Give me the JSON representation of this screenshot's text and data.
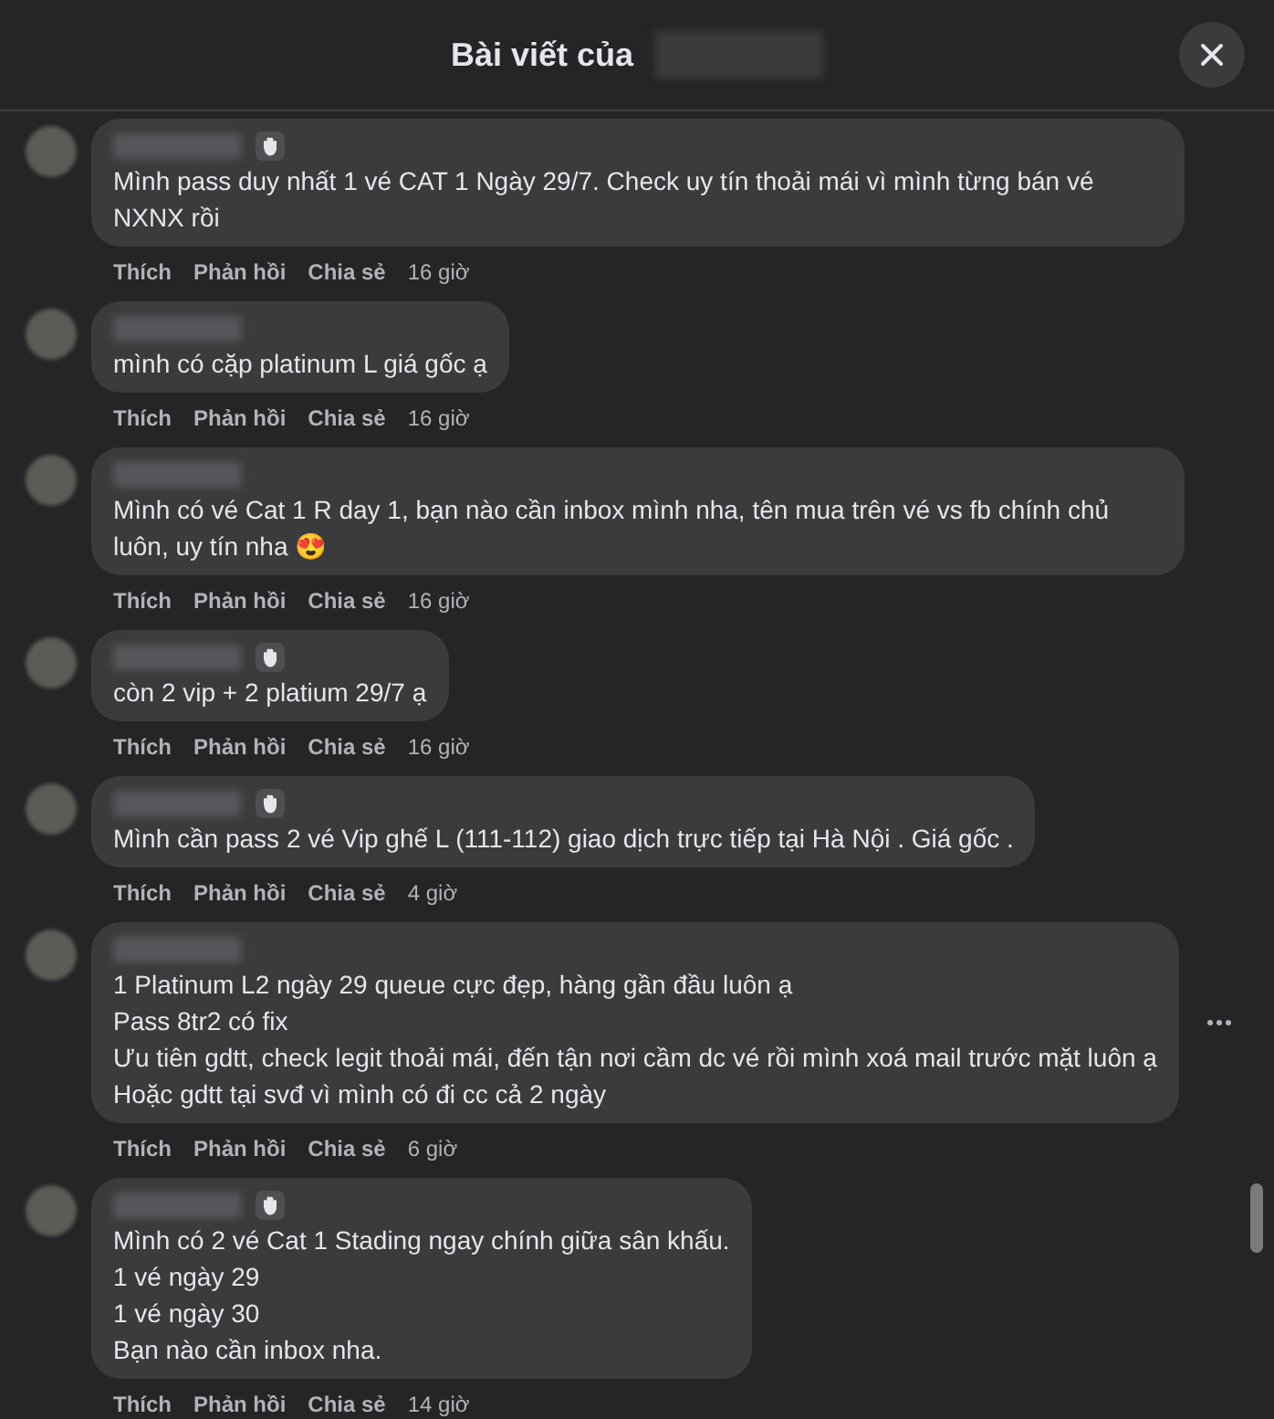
{
  "header": {
    "title": "Bài viết của"
  },
  "comments": [
    {
      "badge": true,
      "lines": [
        "Mình pass duy nhất 1 vé CAT 1 Ngày 29/7. Check uy tín thoải mái vì mình từng bán vé NXNX rồi"
      ],
      "actions": [
        "Thích",
        "Phản hồi",
        "Chia sẻ"
      ],
      "time": "16 giờ",
      "menu": false
    },
    {
      "badge": false,
      "lines": [
        "mình có cặp platinum L giá gốc ạ"
      ],
      "actions": [
        "Thích",
        "Phản hồi",
        "Chia sẻ"
      ],
      "time": "16 giờ",
      "menu": false
    },
    {
      "badge": false,
      "lines": [
        "Mình có vé Cat 1 R day 1, bạn nào cần inbox mình nha, tên mua trên vé vs fb chính chủ luôn, uy tín nha 😍"
      ],
      "actions": [
        "Thích",
        "Phản hồi",
        "Chia sẻ"
      ],
      "time": "16 giờ",
      "menu": false
    },
    {
      "badge": true,
      "lines": [
        "còn 2 vip + 2 platium 29/7 ạ"
      ],
      "actions": [
        "Thích",
        "Phản hồi",
        "Chia sẻ"
      ],
      "time": "16 giờ",
      "menu": false
    },
    {
      "badge": true,
      "lines": [
        "Mình cần pass 2 vé Vip ghế L (111-112) giao dịch trực tiếp tại Hà Nội . Giá gốc ."
      ],
      "actions": [
        "Thích",
        "Phản hồi",
        "Chia sẻ"
      ],
      "time": "4 giờ",
      "menu": false
    },
    {
      "badge": false,
      "lines": [
        "1 Platinum L2 ngày 29 queue cực đẹp, hàng gần đầu luôn ạ",
        "Pass 8tr2 có fix",
        "Ưu tiên gdtt, check legit thoải mái, đến tận nơi cầm dc vé rồi mình xoá mail trước mặt luôn ạ",
        "Hoặc gdtt tại svđ vì mình có đi cc cả 2 ngày"
      ],
      "actions": [
        "Thích",
        "Phản hồi",
        "Chia sẻ"
      ],
      "time": "6 giờ",
      "menu": true
    },
    {
      "badge": true,
      "lines": [
        "Mình có 2 vé Cat 1 Stading ngay chính giữa sân khấu.",
        "1 vé ngày 29",
        "1 vé ngày 30",
        "Bạn nào cần inbox nha."
      ],
      "actions": [
        "Thích",
        "Phản hồi",
        "Chia sẻ"
      ],
      "time": "14 giờ",
      "menu": false
    }
  ]
}
